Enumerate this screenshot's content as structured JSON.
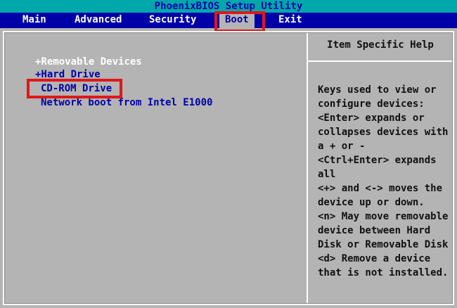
{
  "window": {
    "title": "PhoenixBIOS Setup Utility"
  },
  "menu": {
    "items": [
      {
        "label": "Main"
      },
      {
        "label": "Advanced"
      },
      {
        "label": "Security"
      },
      {
        "label": "Boot",
        "active": true
      },
      {
        "label": "Exit"
      }
    ]
  },
  "boot_list": {
    "items": [
      {
        "label": "+Removable Devices"
      },
      {
        "label": "+Hard Drive"
      },
      {
        "label": "CD-ROM Drive"
      },
      {
        "label": "Network boot from Intel E1000"
      }
    ]
  },
  "help_panel": {
    "title": "Item Specific Help",
    "body": "Keys used to view or\nconfigure devices:\n<Enter> expands or\ncollapses devices with\na + or -\n<Ctrl+Enter> expands\nall\n<+> and <-> moves the\ndevice up or down.\n<n> May move removable\ndevice between Hard\nDisk or Removable Disk\n<d> Remove a device\nthat is not installed."
  },
  "colors": {
    "background": "#b4b4b4",
    "menu_bar": "#0000a8",
    "title_bar": "#00a8ac",
    "highlight_box": "#e01818",
    "item_text": "#0000a8"
  }
}
